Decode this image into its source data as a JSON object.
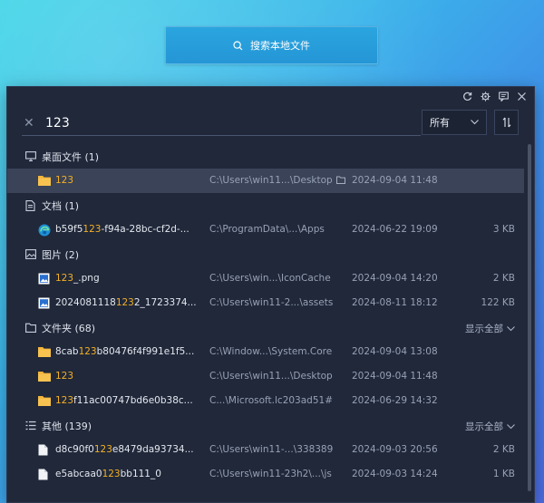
{
  "top_search": {
    "label": "搜索本地文件"
  },
  "search": {
    "query": "123"
  },
  "filter": {
    "selected": "所有"
  },
  "groups": [
    {
      "title": "桌面文件 (1)",
      "icon": "monitor-icon",
      "show_all": null,
      "rows": [
        {
          "icon": "folder-icon",
          "name_parts": [
            "",
            "123",
            ""
          ],
          "path": "C:\\Users\\win11...\\Desktop",
          "path_folder_icon": true,
          "date": "2024-09-04 11:48",
          "size": "",
          "selected": true
        }
      ]
    },
    {
      "title": "文档 (1)",
      "icon": "document-icon",
      "show_all": null,
      "rows": [
        {
          "icon": "edge-icon",
          "name_parts": [
            "b59f5",
            "123",
            "-f94a-28bc-cf2d-..."
          ],
          "path": "C:\\ProgramData\\...\\Apps",
          "date": "2024-06-22 19:09",
          "size": "3 KB"
        }
      ]
    },
    {
      "title": "图片 (2)",
      "icon": "image-icon",
      "show_all": null,
      "rows": [
        {
          "icon": "picture-file-icon",
          "name_parts": [
            "",
            "123",
            "_.png"
          ],
          "path": "C:\\Users\\win...\\IconCache",
          "date": "2024-09-04 14:20",
          "size": "2 KB"
        },
        {
          "icon": "picture-file-icon",
          "name_parts": [
            "2024081118",
            "123",
            "2_1723374..."
          ],
          "path": "C:\\Users\\win11-2...\\assets",
          "date": "2024-08-11 18:12",
          "size": "122 KB"
        }
      ]
    },
    {
      "title": "文件夹 (68)",
      "icon": "folder-outline-icon",
      "show_all": "显示全部",
      "rows": [
        {
          "icon": "folder-icon",
          "name_parts": [
            "8cab",
            "123",
            "b80476f4f991e1f5..."
          ],
          "path": "C:\\Window...\\System.Core",
          "date": "2024-09-04 13:08",
          "size": ""
        },
        {
          "icon": "folder-icon",
          "name_parts": [
            "",
            "123",
            ""
          ],
          "path": "C:\\Users\\win11...\\Desktop",
          "date": "2024-09-04 11:48",
          "size": ""
        },
        {
          "icon": "folder-icon",
          "name_parts": [
            "",
            "123",
            "f11ac00747bd6e0b38c..."
          ],
          "path": "C...\\Microsoft.lc203ad51#",
          "date": "2024-06-29 14:32",
          "size": ""
        }
      ]
    },
    {
      "title": "其他 (139)",
      "icon": "list-icon",
      "show_all": "显示全部",
      "rows": [
        {
          "icon": "file-icon",
          "name_parts": [
            "d8c90f0",
            "123",
            "e8479da93734..."
          ],
          "path": "C:\\Users\\win11-...\\338389",
          "date": "2024-09-03 20:56",
          "size": "2 KB"
        },
        {
          "icon": "file-icon",
          "name_parts": [
            "e5abcaa0",
            "123",
            "bb111_0"
          ],
          "path": "C:\\Users\\win11-23h2\\...\\js",
          "date": "2024-09-03 14:24",
          "size": "1 KB"
        }
      ]
    }
  ],
  "colors": {
    "highlight": "#f5b024",
    "folder": "#f4b53a",
    "panel_bg": "#20283a",
    "selected_row": "#3a4357"
  }
}
